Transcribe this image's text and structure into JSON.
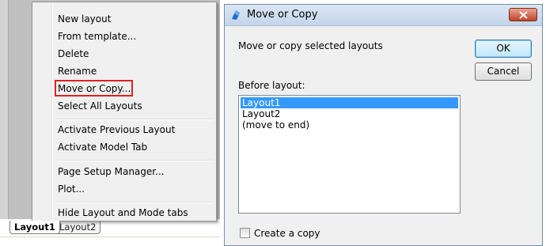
{
  "context_menu": {
    "items": [
      {
        "label": "New layout"
      },
      {
        "label": "From template..."
      },
      {
        "label": "Delete"
      },
      {
        "label": "Rename"
      },
      {
        "label": "Move or Copy..."
      },
      {
        "label": "Select All Layouts"
      },
      {
        "label": "Activate Previous Layout"
      },
      {
        "label": "Activate Model Tab"
      },
      {
        "label": "Page Setup Manager..."
      },
      {
        "label": "Plot..."
      },
      {
        "label": "Hide Layout and Mode tabs"
      }
    ]
  },
  "layout_tabs": [
    "Layout1",
    "Layout2"
  ],
  "dialog": {
    "title": "Move or Copy",
    "description": "Move or copy selected layouts",
    "ok_label": "OK",
    "cancel_label": "Cancel",
    "before_layout_label": "Before layout:",
    "list_items": [
      "Layout1",
      "Layout2",
      "(move to end)"
    ],
    "selected_item": "Layout1",
    "create_copy_label": "Create a copy",
    "create_copy_checked": false
  },
  "colors": {
    "highlight_box": "#e02020",
    "selection": "#3399ff",
    "close_button": "#c0432a"
  }
}
